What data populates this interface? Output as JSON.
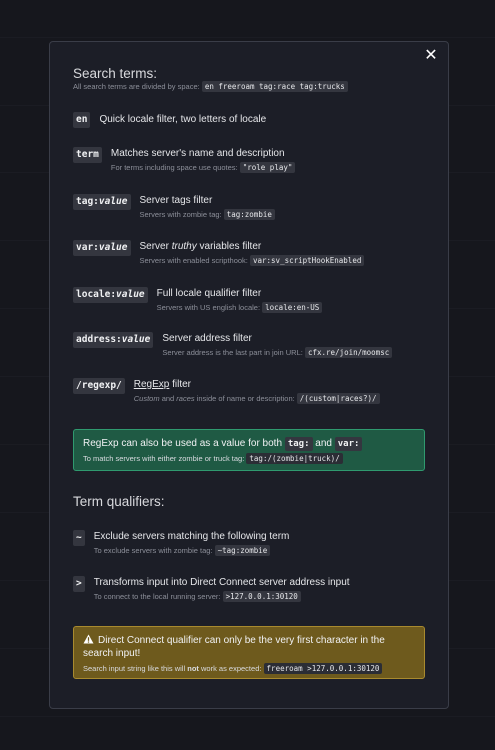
{
  "dialog": {
    "close_label": "✕",
    "search_terms_heading": "Search terms:",
    "intro_text": "All search terms are divided by space:",
    "intro_example": "en freeroam tag:race tag:trucks",
    "terms": [
      {
        "key": "en",
        "key_italic": "",
        "title": "Quick locale filter, two letters of locale",
        "hint": "",
        "example": ""
      },
      {
        "key": "term",
        "key_italic": "",
        "title": "Matches server's name and description",
        "hint": "For terms including space use quotes:",
        "example": "\"role play\""
      },
      {
        "key": "tag:",
        "key_italic": "value",
        "title": "Server tags filter",
        "hint": "Servers with zombie tag:",
        "example": "tag:zombie"
      },
      {
        "key": "var:",
        "key_italic": "value",
        "title_before": "Server ",
        "title_italic": "truthy",
        "title_after": " variables filter",
        "hint": "Servers with enabled scripthook:",
        "example": "var:sv_scriptHookEnabled"
      },
      {
        "key": "locale:",
        "key_italic": "value",
        "title": "Full locale qualifier filter",
        "hint": "Servers with US english locale:",
        "example": "locale:en-US"
      },
      {
        "key": "address:",
        "key_italic": "value",
        "title": "Server address filter",
        "hint": "Server address is the last part in join URL:",
        "example": "cfx.re/join/moomsc"
      },
      {
        "key": "/regexp/",
        "key_italic": "",
        "title_link": "RegExp",
        "title_after": " filter",
        "hint_italic1": "Custom",
        "hint_mid": " and ",
        "hint_italic2": "races",
        "hint_after": " inside of name or description:",
        "example": "/(custom|races?)/"
      }
    ],
    "regexp_note": {
      "text_before": "RegExp can also be used as a value for both",
      "code1": "tag:",
      "text_and": "and",
      "code2": "var:",
      "hint": "To match servers with either zombie or truck tag:",
      "example": "tag:/(zombie|truck)/"
    },
    "qualifiers_heading": "Term qualifiers:",
    "qualifiers": [
      {
        "key": "~",
        "title": "Exclude servers matching the following term",
        "hint": "To exclude servers with zombie tag:",
        "example": "~tag:zombie"
      },
      {
        "key": ">",
        "title": "Transforms input into Direct Connect server address input",
        "hint": "To connect to the local running server:",
        "example": ">127.0.0.1:30120"
      }
    ],
    "warning": {
      "text": "Direct Connect qualifier can only be the very first character in the search input!",
      "hint_before": "Search input string like this will",
      "hint_bold": "not",
      "hint_after": "work as expected:",
      "example": "freeroam >127.0.0.1:30120"
    },
    "colors": {
      "accent_green": "#1f5a44",
      "accent_yellow": "#6e5a1d"
    }
  }
}
